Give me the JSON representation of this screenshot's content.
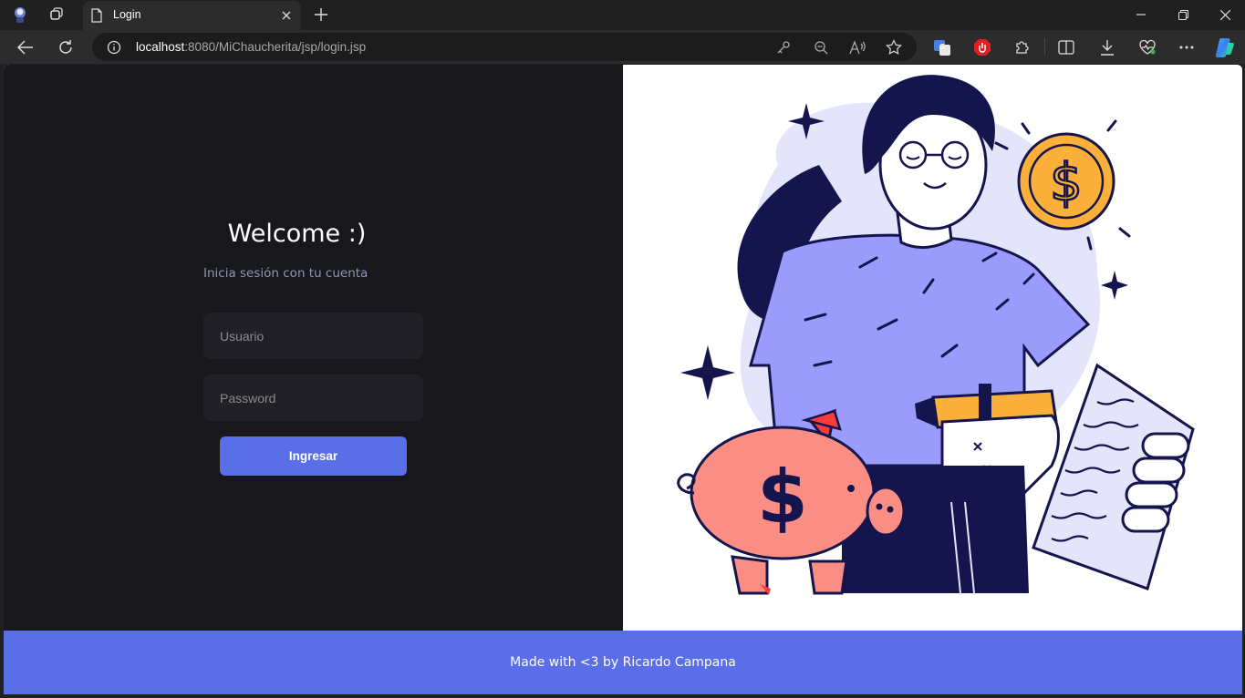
{
  "browser": {
    "tab_title": "Login",
    "url_host": "localhost",
    "url_path": ":8080/MiChaucherita/jsp/login.jsp"
  },
  "login": {
    "heading": "Welcome :)",
    "subheading": "Inicia sesión con tu cuenta",
    "username_placeholder": "Usuario",
    "password_placeholder": "Password",
    "submit_label": "Ingresar"
  },
  "footer": {
    "text": "Made with <3 by Ricardo Campana"
  },
  "colors": {
    "accent": "#5a6ee8",
    "panel_dark": "#18171c",
    "field_bg": "#212026"
  },
  "illustration": "woman-with-piggy-bank-coin-and-document"
}
